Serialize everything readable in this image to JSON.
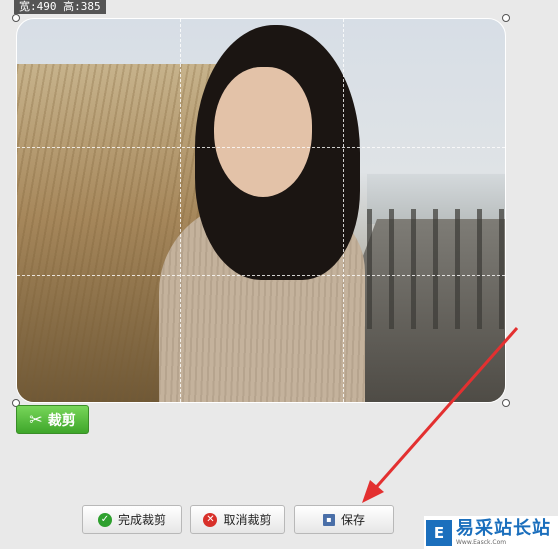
{
  "size_label": "宽:490 高:385",
  "crop_button": {
    "label": "裁剪",
    "icon": "scissors-icon"
  },
  "actions": {
    "finish": {
      "label": "完成裁剪",
      "icon": "check-circle-icon",
      "color": "#2ea02e"
    },
    "cancel": {
      "label": "取消裁剪",
      "icon": "x-circle-icon",
      "color": "#d8302a"
    },
    "save": {
      "label": "保存",
      "icon": "disk-icon"
    }
  },
  "annotation": {
    "color": "#e33030"
  },
  "watermark": {
    "logo": "E",
    "text": "易采站长站",
    "sub": "Www.Easck.Com"
  }
}
